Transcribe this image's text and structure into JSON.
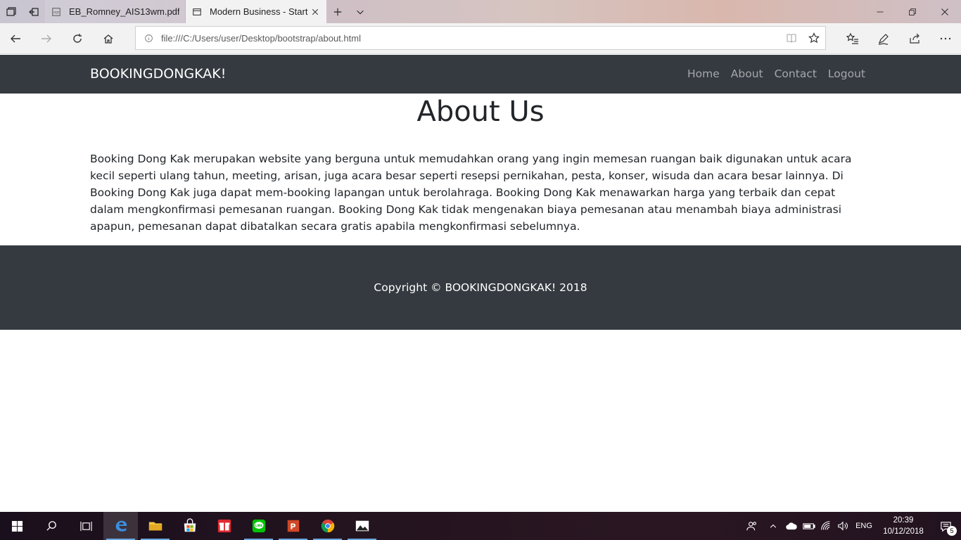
{
  "browser": {
    "tabs": [
      {
        "title": "EB_Romney_AIS13wm.pdf",
        "icon": "pdf-icon",
        "active": false
      },
      {
        "title": "Modern Business - Start",
        "icon": "page-icon",
        "active": true
      }
    ],
    "address": "file:///C:/Users/user/Desktop/bootstrap/about.html"
  },
  "site": {
    "brand": "BOOKINGDONGKAK!",
    "nav": [
      "Home",
      "About",
      "Contact",
      "Logout"
    ],
    "heading": "About Us",
    "body": "Booking Dong Kak merupakan website yang berguna untuk memudahkan orang yang ingin memesan ruangan baik digunakan untuk acara kecil seperti ulang tahun, meeting, arisan, juga acara besar seperti resepsi pernikahan, pesta, konser, wisuda dan acara besar lainnya. Di Booking Dong Kak juga dapat mem-booking lapangan untuk berolahraga. Booking Dong Kak menawarkan harga yang terbaik dan cepat dalam mengkonfirmasi pemesanan ruangan. Booking Dong Kak tidak mengenakan biaya pemesanan atau menambah biaya administrasi apapun, pemesanan dapat dibatalkan secara gratis apabila mengkonfirmasi sebelumnya.",
    "copyright": "Copyright © BOOKINGDONGKAK! 2018"
  },
  "taskbar": {
    "language": "ENG",
    "time": "20:39",
    "date": "10/12/2018",
    "notifications": "5"
  },
  "colors": {
    "navbar": "#343a40",
    "footer": "#343a40",
    "text": "#212529"
  }
}
